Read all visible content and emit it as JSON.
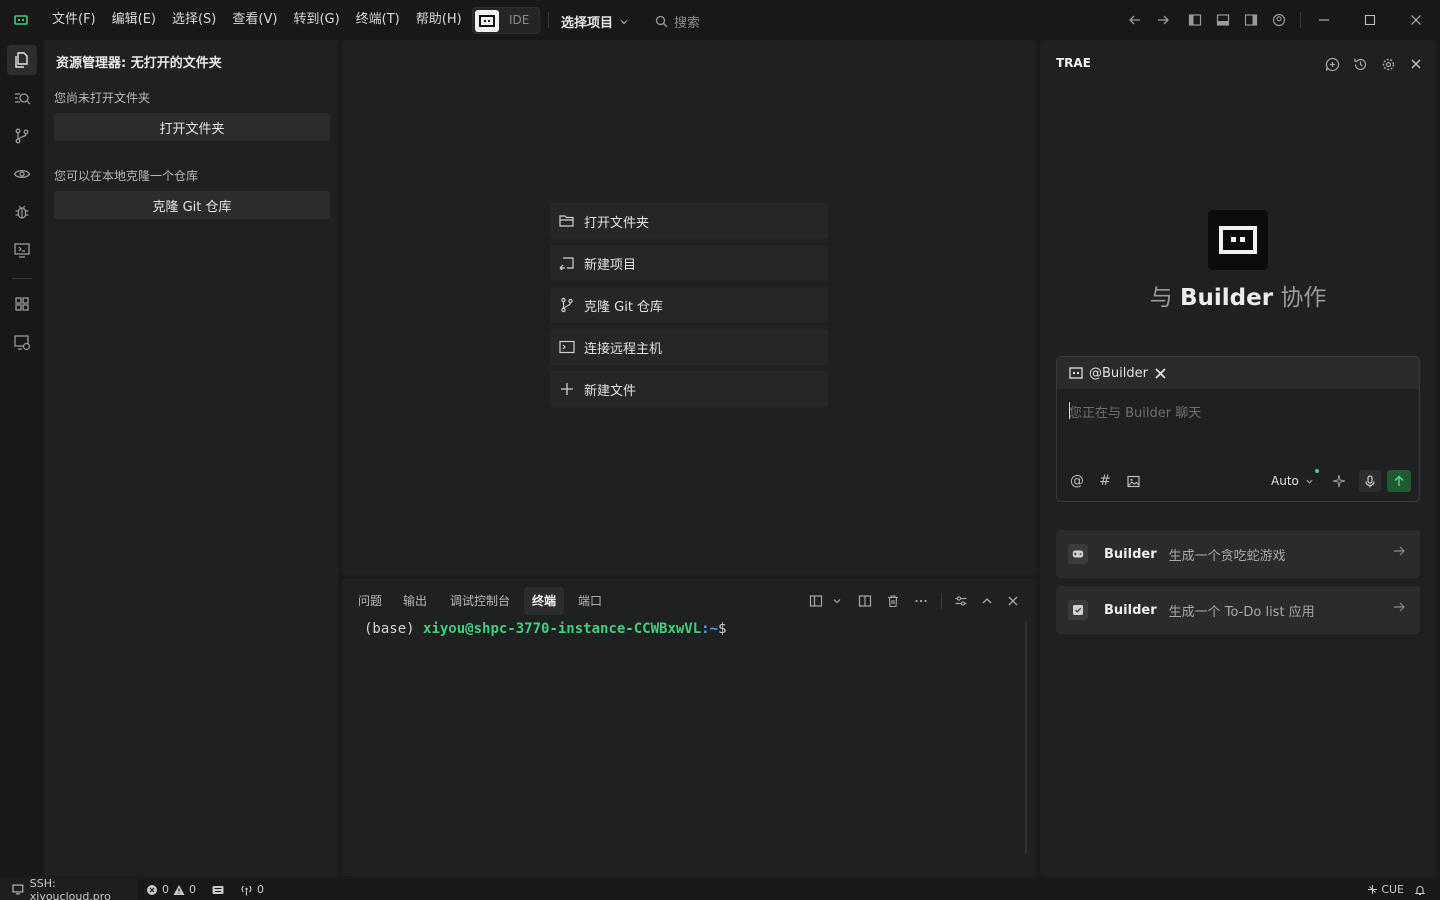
{
  "menu": [
    "文件(F)",
    "编辑(E)",
    "选择(S)",
    "查看(V)",
    "转到(G)",
    "终端(T)",
    "帮助(H)"
  ],
  "ide_label": "IDE",
  "project_select": "选择项目",
  "search_placeholder": "搜索",
  "explorer": {
    "title": "资源管理器: 无打开的文件夹",
    "no_folder_text": "您尚未打开文件夹",
    "open_folder_button": "打开文件夹",
    "clone_text": "您可以在本地克隆一个仓库",
    "clone_button": "克隆 Git 仓库"
  },
  "start_items": [
    {
      "label": "打开文件夹",
      "icon": "folder-open-icon"
    },
    {
      "label": "新建项目",
      "icon": "new-project-icon"
    },
    {
      "label": "克隆 Git 仓库",
      "icon": "git-branch-icon"
    },
    {
      "label": "连接远程主机",
      "icon": "remote-terminal-icon"
    },
    {
      "label": "新建文件",
      "icon": "plus-icon"
    }
  ],
  "panel": {
    "tabs": [
      "问题",
      "输出",
      "调试控制台",
      "终端",
      "端口"
    ],
    "active_tab": "终端",
    "terminal": {
      "env": "(base)",
      "user_host": "xiyou@shpc-3770-instance-CCWBxwVL",
      "path": ":~",
      "prompt": "$"
    }
  },
  "chat": {
    "title": "TRAE",
    "heading_prefix": "与",
    "heading_agent": "Builder",
    "heading_suffix": "协作",
    "agent_tag": "@Builder",
    "placeholder": "您正在与 Builder 聊天",
    "model": "Auto",
    "suggestions": [
      {
        "agent": "Builder",
        "text": "生成一个贪吃蛇游戏",
        "icon": "gamepad-icon"
      },
      {
        "agent": "Builder",
        "text": "生成一个 To-Do list 应用",
        "icon": "checkbox-icon"
      }
    ]
  },
  "status": {
    "ssh": "SSH: xiyoucloud.pro",
    "errors": "0",
    "warnings": "0",
    "ports": "0",
    "cue": "CUE"
  },
  "colors": {
    "accent_green": "#3fd07a",
    "send_button": "#1f5a33",
    "terminal_path_blue": "#4aa3ff"
  }
}
